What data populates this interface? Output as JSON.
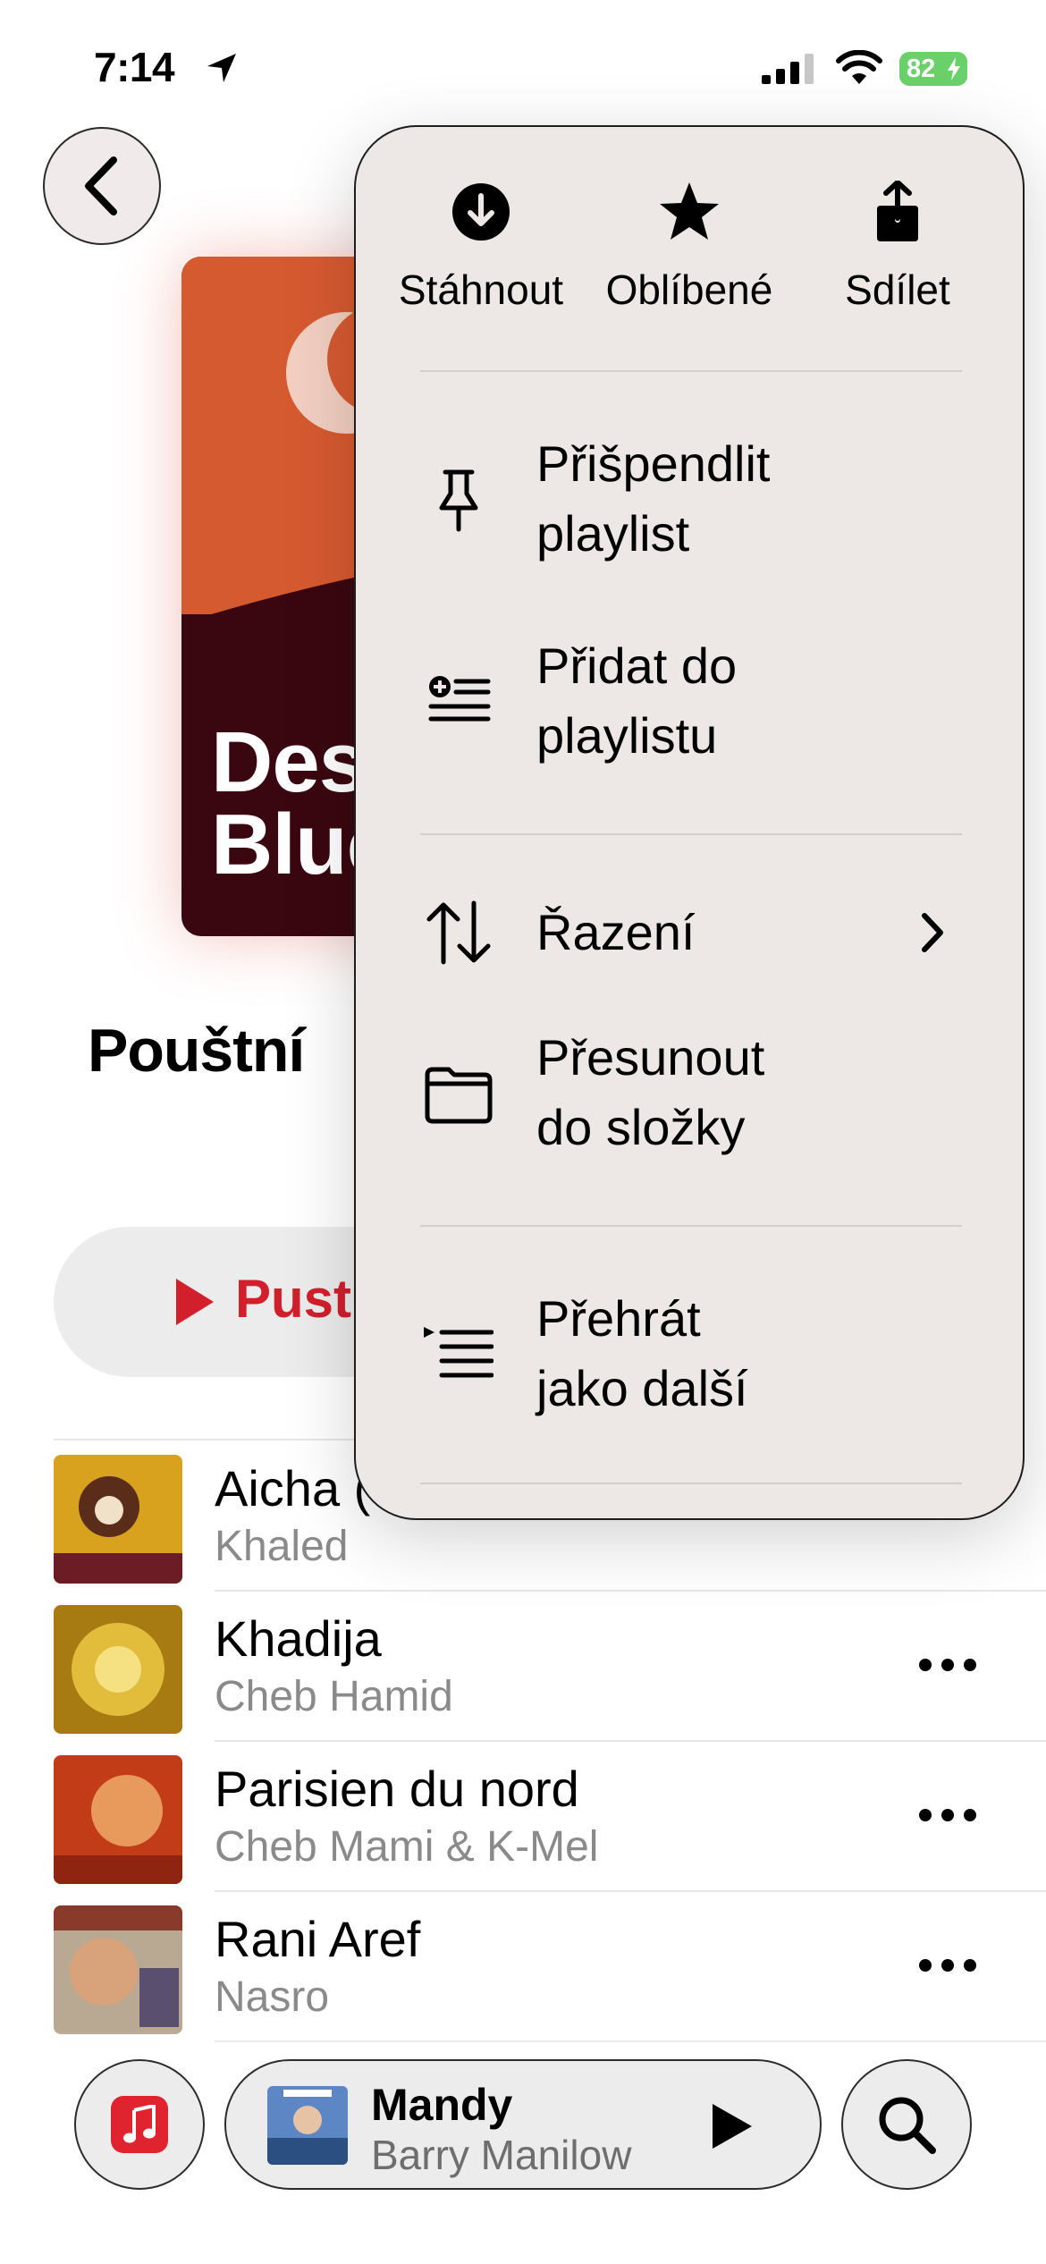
{
  "status_bar": {
    "time": "7:14",
    "battery": "82",
    "icons": [
      "location-arrow-icon",
      "cellular-signal-icon",
      "wifi-icon",
      "battery-charging-icon"
    ]
  },
  "nav": {
    "back_icon": "chevron-left-icon"
  },
  "artwork": {
    "title_line1": "Des",
    "title_line2": "Blue",
    "colors": {
      "top": "#d65a30",
      "bottom": "#3a0710",
      "moon": "#f3cfc2"
    }
  },
  "playlist": {
    "title": "Pouštní",
    "play_label": "Pust",
    "accent": "#d21f2c"
  },
  "songs": [
    {
      "title": "Aicha (",
      "artist": "Khaled",
      "more_icon": "ellipsis-icon"
    },
    {
      "title": "Khadija",
      "artist": "Cheb Hamid",
      "more_icon": "ellipsis-icon"
    },
    {
      "title": "Parisien du nord",
      "artist": "Cheb Mami & K-Mel",
      "more_icon": "ellipsis-icon"
    },
    {
      "title": "Rani Aref",
      "artist": "Nasro",
      "more_icon": "ellipsis-icon"
    }
  ],
  "menu": {
    "actions": [
      {
        "label": "Stáhnout",
        "icon": "download-circle-icon"
      },
      {
        "label": "Oblíbené",
        "icon": "star-icon"
      },
      {
        "label": "Sdílet",
        "icon": "share-icon"
      }
    ],
    "items": [
      {
        "line1": "Přišpendlit",
        "line2": "playlist",
        "icon": "pin-icon"
      },
      {
        "line1": "Přidat do",
        "line2": "playlistu",
        "icon": "add-to-list-icon"
      },
      {
        "line1": "Řazení",
        "line2": "",
        "icon": "sort-arrows-icon",
        "chevron": "chevron-right-icon"
      },
      {
        "line1": "Přesunout",
        "line2": "do složky",
        "icon": "folder-icon"
      },
      {
        "line1": "Přehrát",
        "line2": "jako další",
        "icon": "play-next-icon"
      }
    ]
  },
  "bottom_bar": {
    "library_icon": "music-note-icon",
    "now_playing": {
      "title": "Mandy",
      "artist": "Barry Manilow",
      "play_icon": "play-icon"
    },
    "search_icon": "search-icon"
  }
}
